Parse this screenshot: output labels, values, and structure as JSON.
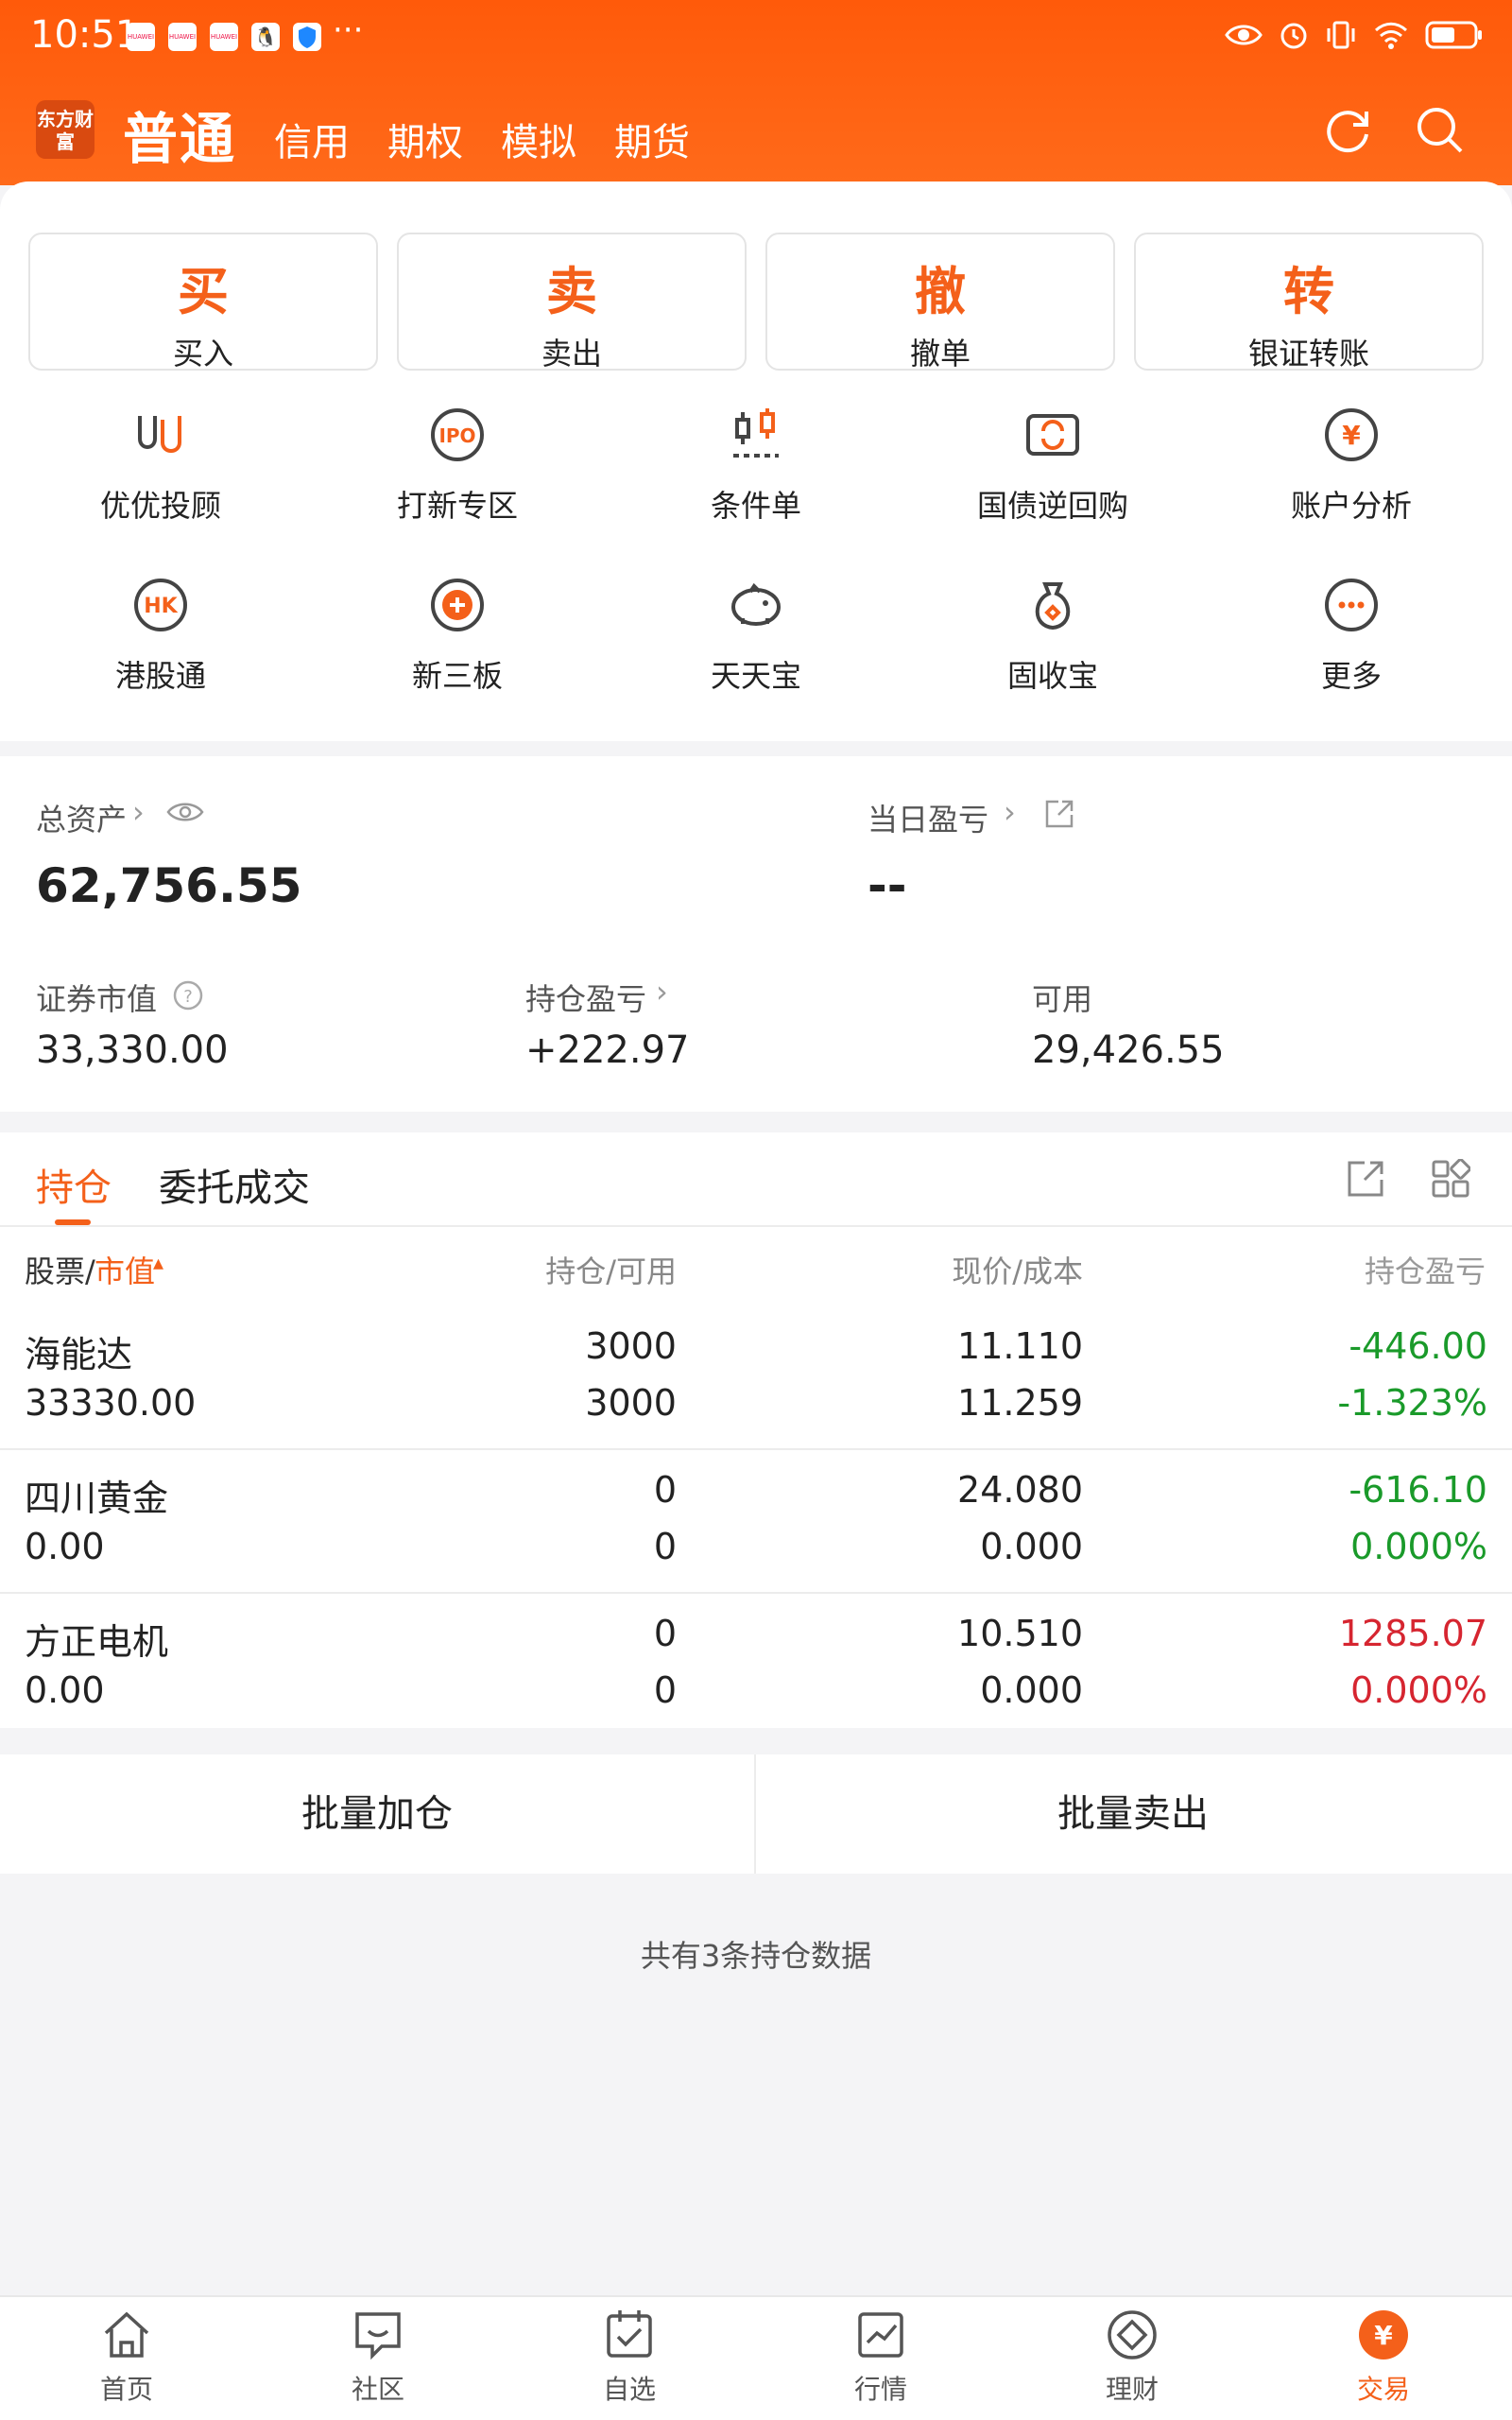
{
  "status_bar": {
    "time": "10:51",
    "app_icons": [
      "huawei-icon",
      "huawei-icon",
      "huawei-icon",
      "qq-icon",
      "shield-icon"
    ],
    "more": "···"
  },
  "header": {
    "logo": "东方财富",
    "active_tab": "普通",
    "tabs": [
      "信用",
      "期权",
      "模拟",
      "期货"
    ]
  },
  "trade_actions": [
    {
      "char": "买",
      "label": "买入"
    },
    {
      "char": "卖",
      "label": "卖出"
    },
    {
      "char": "撤",
      "label": "撤单"
    },
    {
      "char": "转",
      "label": "银证转账"
    }
  ],
  "functions": [
    {
      "label": "优优投顾",
      "icon": "uu-advisor-icon"
    },
    {
      "label": "打新专区",
      "icon": "ipo-icon"
    },
    {
      "label": "条件单",
      "icon": "candlestick-icon"
    },
    {
      "label": "国债逆回购",
      "icon": "bond-repo-icon"
    },
    {
      "label": "账户分析",
      "icon": "yuan-chart-icon"
    },
    {
      "label": "港股通",
      "icon": "hk-icon"
    },
    {
      "label": "新三板",
      "icon": "xinsanban-icon"
    },
    {
      "label": "天天宝",
      "icon": "piggy-bank-icon"
    },
    {
      "label": "固收宝",
      "icon": "money-bag-icon"
    },
    {
      "label": "更多",
      "icon": "more-icon"
    }
  ],
  "account": {
    "total_assets_label": "总资产",
    "total_assets_value": "62,756.55",
    "daily_pnl_label": "当日盈亏",
    "daily_pnl_value": "--",
    "market_value_label": "证券市值",
    "market_value": "33,330.00",
    "holding_pnl_label": "持仓盈亏",
    "holding_pnl": "+222.97",
    "available_label": "可用",
    "available": "29,426.55"
  },
  "holdings": {
    "tabs": [
      "持仓",
      "委托成交"
    ],
    "head": {
      "stock": "股票/",
      "mv": "市值",
      "qty": "持仓/可用",
      "price": "现价/成本",
      "pnl": "持仓盈亏"
    },
    "rows": [
      {
        "name": "海能达",
        "mv": "33330.00",
        "qty": "3000",
        "avail": "3000",
        "price": "11.110",
        "cost": "11.259",
        "pnl": "-446.00",
        "pct": "-1.323%",
        "color": "#1a9a2a"
      },
      {
        "name": "四川黄金",
        "mv": "0.00",
        "qty": "0",
        "avail": "0",
        "price": "24.080",
        "cost": "0.000",
        "pnl": "-616.10",
        "pct": "0.000%",
        "color": "#1a9a2a"
      },
      {
        "name": "方正电机",
        "mv": "0.00",
        "qty": "0",
        "avail": "0",
        "price": "10.510",
        "cost": "0.000",
        "pnl": "1285.07",
        "pct": "0.000%",
        "color": "#d62530"
      }
    ]
  },
  "batch": {
    "add": "批量加仓",
    "sell": "批量卖出"
  },
  "footer_note": "共有3条持仓数据",
  "tabbar": [
    {
      "label": "首页",
      "icon": "home-icon"
    },
    {
      "label": "社区",
      "icon": "community-icon"
    },
    {
      "label": "自选",
      "icon": "watchlist-icon"
    },
    {
      "label": "行情",
      "icon": "market-icon"
    },
    {
      "label": "理财",
      "icon": "wealth-icon"
    },
    {
      "label": "交易",
      "icon": "trade-icon"
    }
  ],
  "colors": {
    "brand": "#ff5a0a",
    "accent": "#f4601a",
    "up": "#d62530",
    "down": "#1a9a2a"
  }
}
